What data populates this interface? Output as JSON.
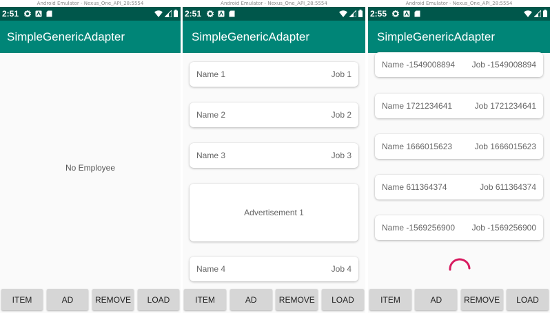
{
  "emulator_title": "Android Emulator - Nexus_One_API_28:5554",
  "app_title": "SimpleGenericAdapter",
  "colors": {
    "primary": "#008577",
    "primary_dark": "#00574b",
    "accent": "#d81b60"
  },
  "buttons": {
    "item": "ITEM",
    "ad": "AD",
    "remove": "REMOVE",
    "load": "LOAD"
  },
  "screen1": {
    "time": "2:51",
    "empty_text": "No Employee"
  },
  "screen2": {
    "time": "2:51",
    "items": [
      {
        "name": "Name 1",
        "job": "Job 1"
      },
      {
        "name": "Name 2",
        "job": "Job 2"
      },
      {
        "name": "Name 3",
        "job": "Job 3"
      },
      {
        "ad": "Advertisement 1"
      },
      {
        "name": "Name 4",
        "job": "Job 4"
      }
    ]
  },
  "screen3": {
    "time": "2:55",
    "items": [
      {
        "name": "Name -1549008894",
        "job": "Job -1549008894"
      },
      {
        "name": "Name 1721234641",
        "job": "Job 1721234641"
      },
      {
        "name": "Name 1666015623",
        "job": "Job 1666015623"
      },
      {
        "name": "Name 611364374",
        "job": "Job 611364374"
      },
      {
        "name": "Name -1569256900",
        "job": "Job -1569256900"
      }
    ],
    "loading": true
  }
}
